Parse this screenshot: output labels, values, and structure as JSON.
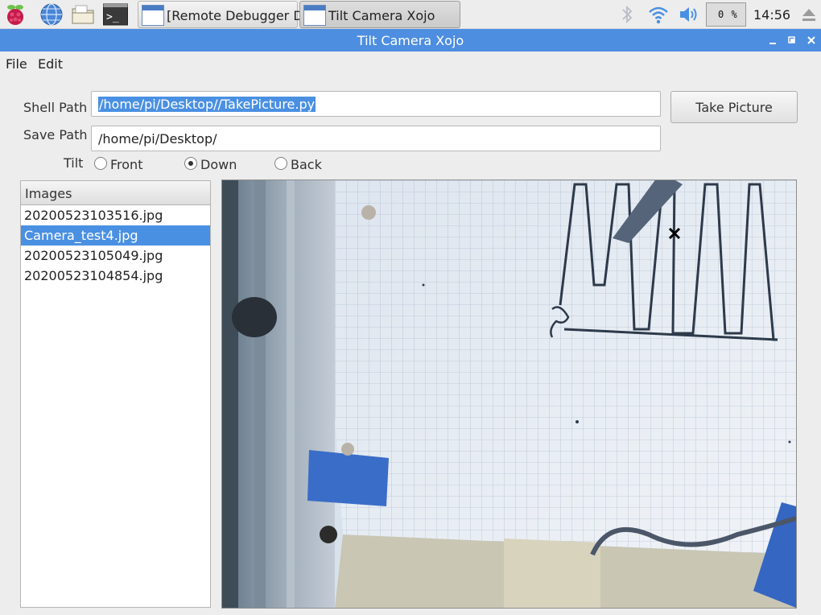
{
  "taskbar": {
    "icons": [
      "raspberry-menu-icon",
      "web-browser-icon",
      "file-manager-icon",
      "terminal-icon"
    ],
    "terminal_glyph": ">_",
    "tasks": [
      {
        "label": "[Remote Debugger D...",
        "active": false
      },
      {
        "label": "Tilt Camera Xojo",
        "active": true
      }
    ],
    "cpu": "0 %",
    "clock": "14:56"
  },
  "window": {
    "title": "Tilt Camera Xojo"
  },
  "menu": {
    "file": "File",
    "edit": "Edit"
  },
  "form": {
    "shell_path_label": "Shell Path",
    "shell_path_value": "/home/pi/Desktop//TakePicture.py",
    "save_path_label": "Save Path",
    "save_path_value": "/home/pi/Desktop/",
    "take_picture_label": "Take Picture",
    "tilt_label": "Tilt",
    "tilt_options": [
      {
        "label": "Front",
        "selected": false
      },
      {
        "label": "Down",
        "selected": true
      },
      {
        "label": "Back",
        "selected": false
      }
    ]
  },
  "images_list": {
    "header": "Images",
    "items": [
      {
        "label": "20200523103516.jpg",
        "selected": false
      },
      {
        "label": "Camera_test4.jpg",
        "selected": true
      },
      {
        "label": "20200523105049.jpg",
        "selected": false
      },
      {
        "label": "20200523104854.jpg",
        "selected": false
      }
    ]
  },
  "colors": {
    "titlebar": "#4d8ee0",
    "selection": "#4a90e2"
  }
}
